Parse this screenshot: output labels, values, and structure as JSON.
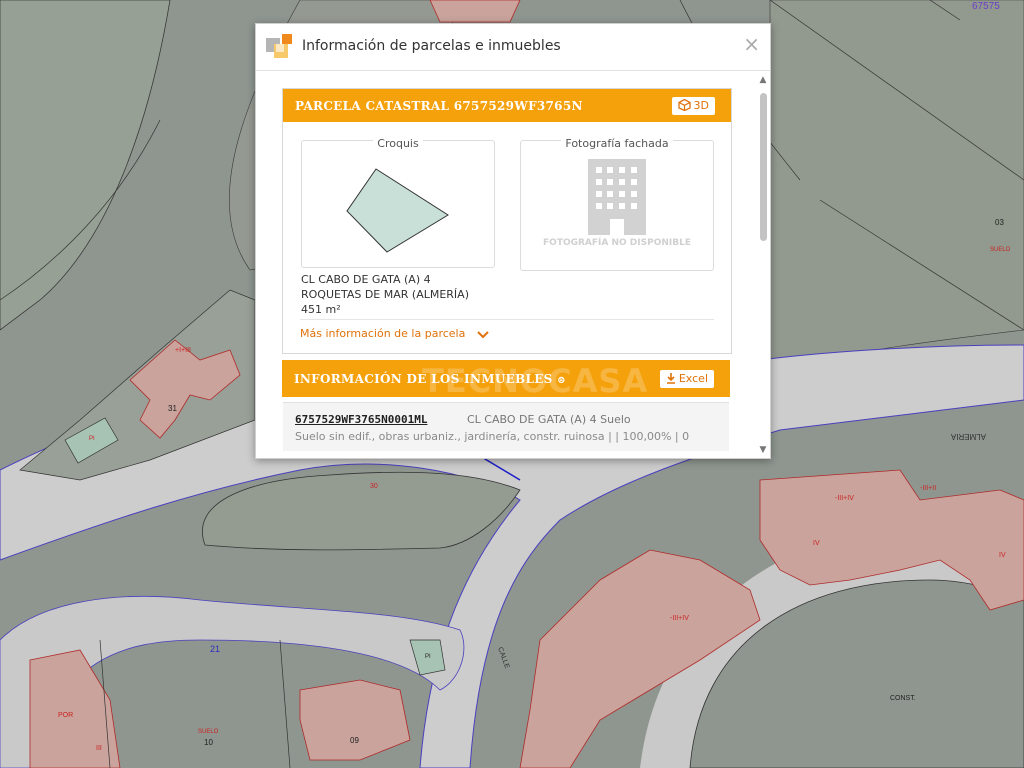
{
  "dialog": {
    "title": "Información de parcelas e inmuebles",
    "close_icon": "×"
  },
  "parcela": {
    "header": "PARCELA CATASTRAL 6757529WF3765N",
    "btn_3d": "3D",
    "croquis_label": "Croquis",
    "foto_label": "Fotografía fachada",
    "foto_missing": "FOTOGRAFÍA NO DISPONIBLE",
    "address_line1": "CL CABO DE GATA (A) 4",
    "address_line2": "ROQUETAS DE MAR (ALMERÍA)",
    "area": "451 m²",
    "more_info": "Más información de la parcela"
  },
  "inmuebles": {
    "header": "INFORMACIÓN DE LOS INMUEBLES",
    "header_icon": "⊜",
    "excel_label": "Excel",
    "watermark": "TECNOCASA",
    "items": [
      {
        "ref": "6757529WF3765N0001ML",
        "address": "CL CABO DE GATA (A) 4 Suelo",
        "description": "Suelo sin edif., obras urbaniz., jardinería, constr. ruinosa | | 100,00% | 0"
      }
    ]
  },
  "map": {
    "labels": [
      "67575",
      "03",
      "SUELO",
      "ALMERIA",
      "31",
      "PI",
      "30",
      "CALLE",
      "21",
      "PI",
      "10",
      "SUELO",
      "09",
      "CONST.",
      "POR",
      "III",
      "IV",
      "-III+IV",
      "-III+IV",
      "-III+II",
      "+I+III"
    ]
  },
  "colors": {
    "accent": "#f5a10c",
    "map_bg": "#8f968f",
    "road": "#cfcfcf",
    "parcel": "#c8a19a"
  }
}
